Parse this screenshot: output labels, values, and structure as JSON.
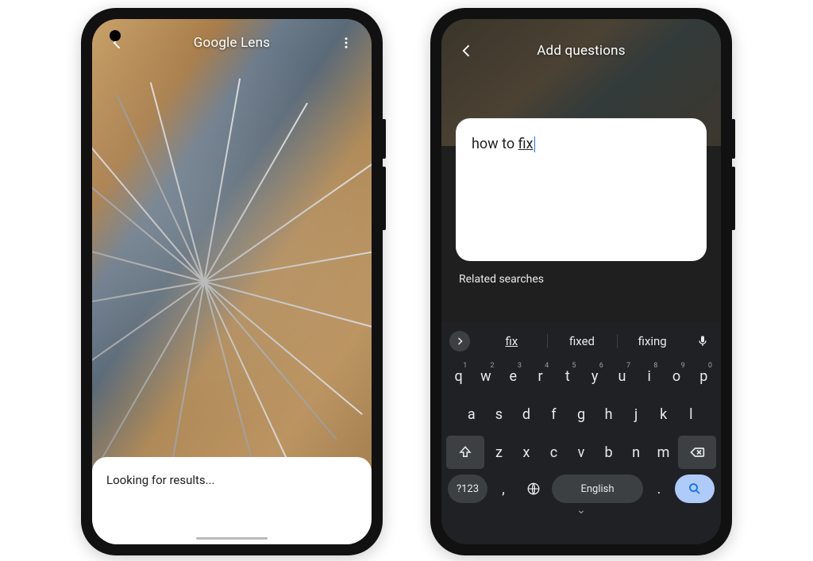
{
  "left_phone": {
    "app_title": "Google Lens",
    "status_text": "Looking for results..."
  },
  "right_phone": {
    "header_title": "Add questions",
    "input_prefix": "how to ",
    "input_underlined": "fix",
    "related_label": "Related searches",
    "suggestions": [
      "fix",
      "fixed",
      "fixing"
    ],
    "keyboard": {
      "row1": [
        {
          "k": "q",
          "n": "1"
        },
        {
          "k": "w",
          "n": "2"
        },
        {
          "k": "e",
          "n": "3"
        },
        {
          "k": "r",
          "n": "4"
        },
        {
          "k": "t",
          "n": "5"
        },
        {
          "k": "y",
          "n": "6"
        },
        {
          "k": "u",
          "n": "7"
        },
        {
          "k": "i",
          "n": "8"
        },
        {
          "k": "o",
          "n": "9"
        },
        {
          "k": "p",
          "n": "0"
        }
      ],
      "row2": [
        "a",
        "s",
        "d",
        "f",
        "g",
        "h",
        "j",
        "k",
        "l"
      ],
      "row3": [
        "z",
        "x",
        "c",
        "v",
        "b",
        "n",
        "m"
      ],
      "symbols_label": "?123",
      "space_label": "English",
      "comma": ",",
      "dot": "."
    }
  }
}
